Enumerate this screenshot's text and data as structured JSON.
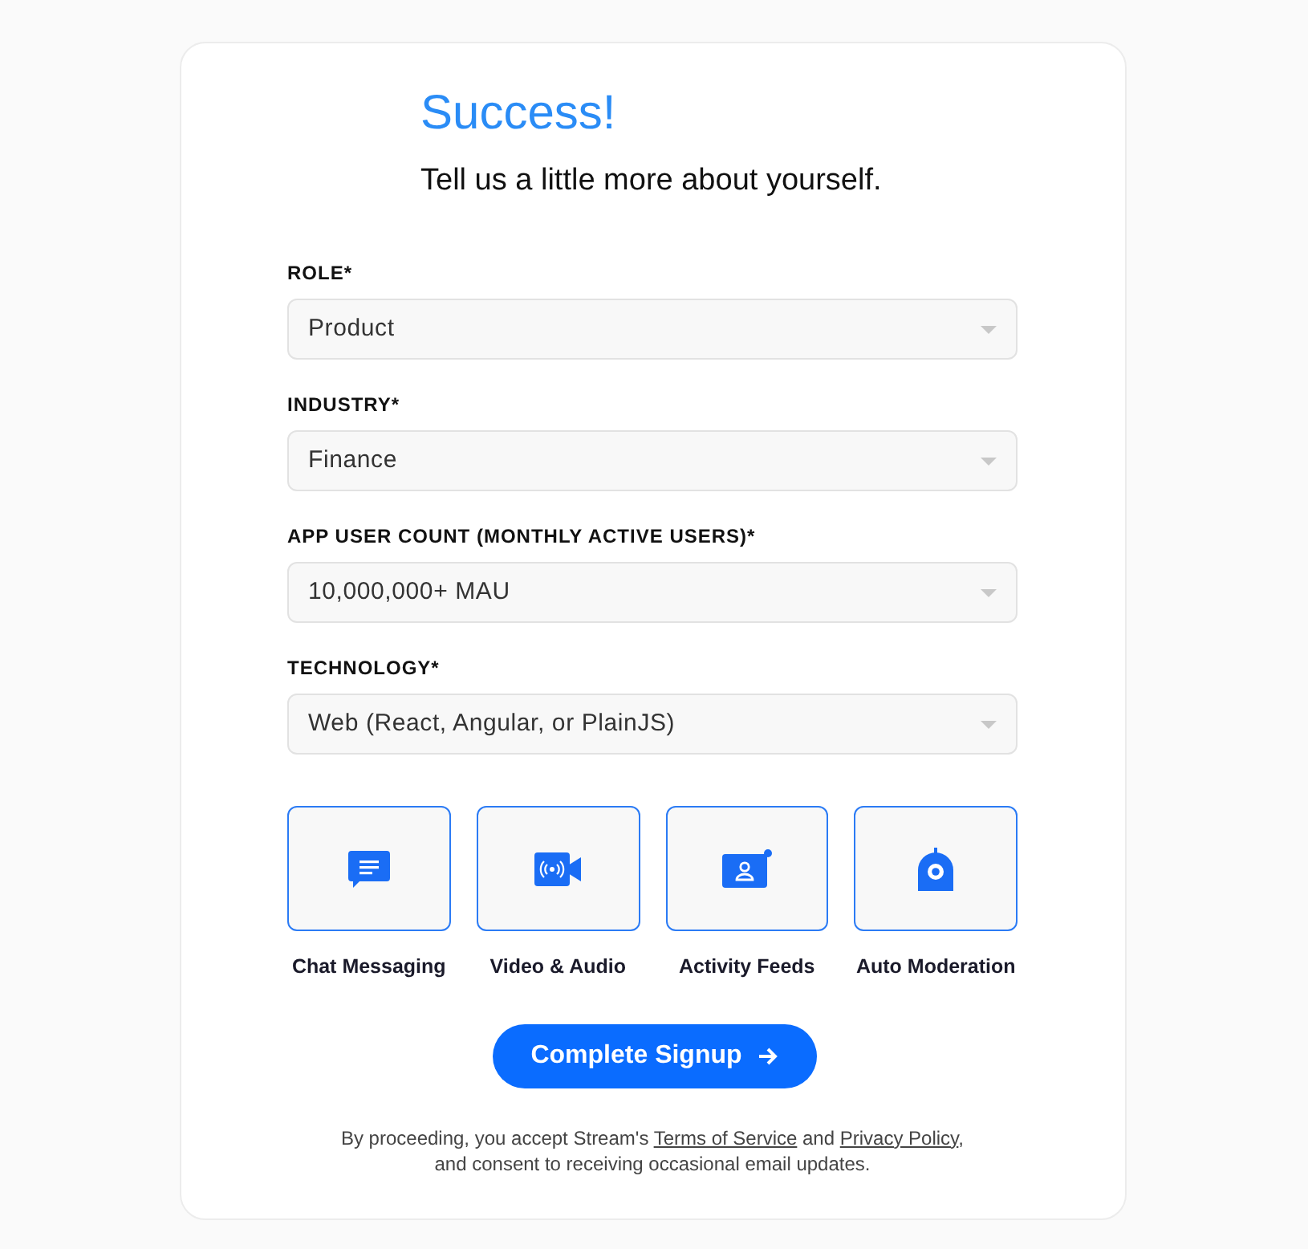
{
  "title": "Success!",
  "subtitle": "Tell us a little more about yourself.",
  "fields": [
    {
      "label": "ROLE*",
      "value": "Product"
    },
    {
      "label": "INDUSTRY*",
      "value": "Finance"
    },
    {
      "label": "APP USER COUNT (MONTHLY ACTIVE USERS)*",
      "value": "10,000,000+ MAU"
    },
    {
      "label": "TECHNOLOGY*",
      "value": "Web (React, Angular, or PlainJS)"
    }
  ],
  "products": [
    {
      "kind": "chat",
      "label": "Chat Messaging",
      "selected": true
    },
    {
      "kind": "video",
      "label": "Video & Audio",
      "selected": true
    },
    {
      "kind": "feeds",
      "label": "Activity Feeds",
      "selected": true
    },
    {
      "kind": "moderation",
      "label": "Auto Moderation",
      "selected": true
    }
  ],
  "submit": "Complete Signup",
  "legal": [
    {
      "kind": "text",
      "text": "By proceeding, you accept Stream's "
    },
    {
      "kind": "link",
      "text": "Terms of Service"
    },
    {
      "kind": "text",
      "text": " and "
    },
    {
      "kind": "link",
      "text": "Privacy Policy"
    },
    {
      "kind": "text",
      "text": ", and consent to receiving occasional email updates."
    }
  ]
}
